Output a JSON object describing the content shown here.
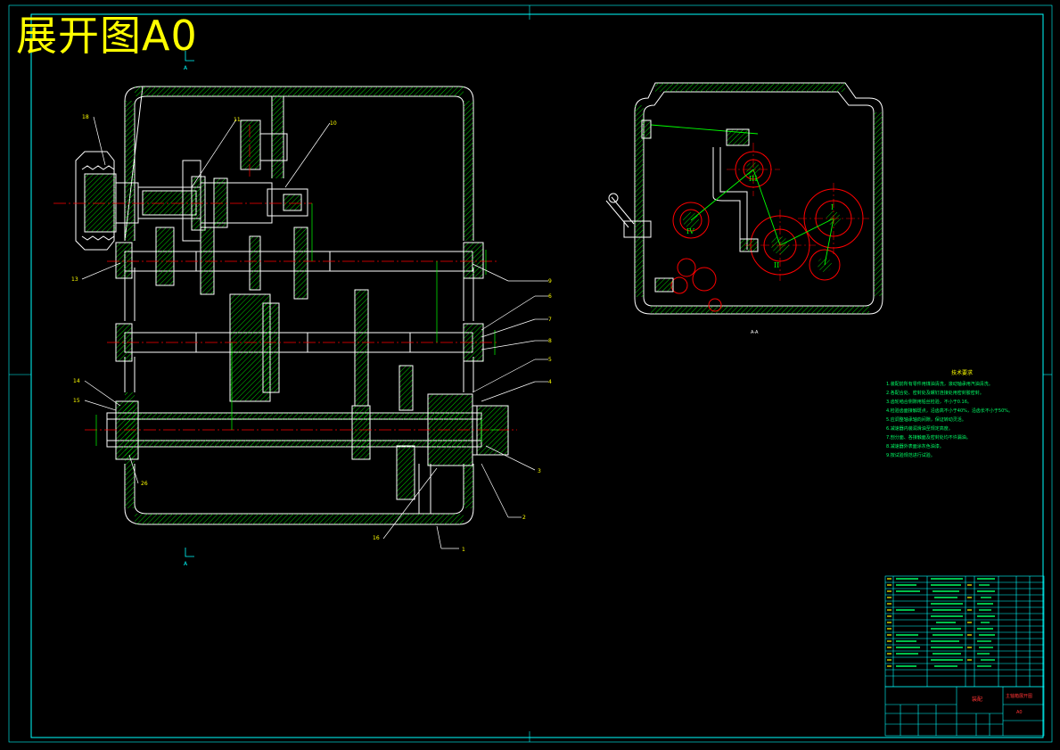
{
  "title": "展开图A0",
  "section_label": "A-A",
  "section_marks": [
    "A",
    "A"
  ],
  "part_labels": [
    "1",
    "2",
    "3",
    "4",
    "5",
    "6",
    "7",
    "8",
    "9",
    "10",
    "11",
    "13",
    "14",
    "15",
    "16",
    "18",
    "26"
  ],
  "roman_numerals": [
    "I",
    "II",
    "III",
    "IV"
  ],
  "tech_notes": {
    "title": "技术要求",
    "lines": [
      "1.装配前所有零件用煤油清洗，滚动轴承用汽油清洗。",
      "2.各配合处、密封处及螺钉连接处用密封胶密封。",
      "3.齿轮啮合侧隙用铅丝检验，不小于0.16。",
      "4.检验齿面接触斑点，沿齿高不小于40%，沿齿长不小于50%。",
      "5.应调整轴承轴向间隙，保证转动灵活。",
      "6.减速器内装润滑油至规定高度。",
      "7.剖分面、各接触面及密封处均不许漏油。",
      "8.减速器外表面涂灰色油漆。",
      "9.按试验规范进行试验。"
    ]
  },
  "title_block": {
    "drawing_name": "主轴箱展开图",
    "label": "装配",
    "drawing_number": "A0"
  },
  "colors": {
    "outline": "#ffffff",
    "centerline": "#ff0000",
    "dimension": "#00ff00",
    "hatch": "#00ff00",
    "leader": "#ffffff",
    "frame": "#00ffff",
    "title": "#ffff00"
  }
}
